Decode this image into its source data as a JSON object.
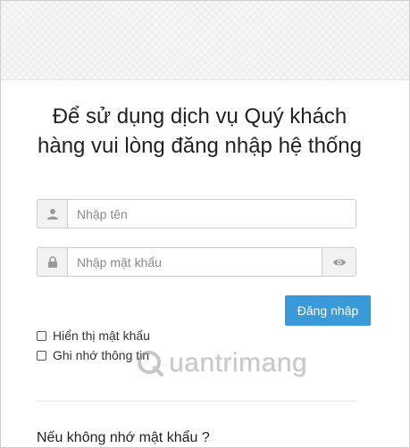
{
  "login": {
    "title": "Để sử dụng dịch vụ Quý khách hàng vui lòng đăng nhập hệ thống",
    "username": {
      "placeholder": "Nhập tên",
      "value": ""
    },
    "password": {
      "placeholder": "Nhập mật khẩu",
      "value": ""
    },
    "submit_label": "Đăng nhập",
    "show_password_label": "Hiển thị mật khẩu",
    "remember_label": "Ghi nhớ thông tin",
    "forgot_text": "Nếu không nhớ mật khẩu ?"
  },
  "watermark": {
    "text": "uantrimang"
  },
  "icons": {
    "user": "user-icon",
    "lock": "lock-icon",
    "eye": "eye-icon",
    "watermark_logo": "quantrimang-logo-icon"
  },
  "colors": {
    "primary": "#3a9ad9",
    "border": "#cccccc",
    "addon_bg": "#f2f2f2",
    "header_bg": "#f6f6f6"
  }
}
